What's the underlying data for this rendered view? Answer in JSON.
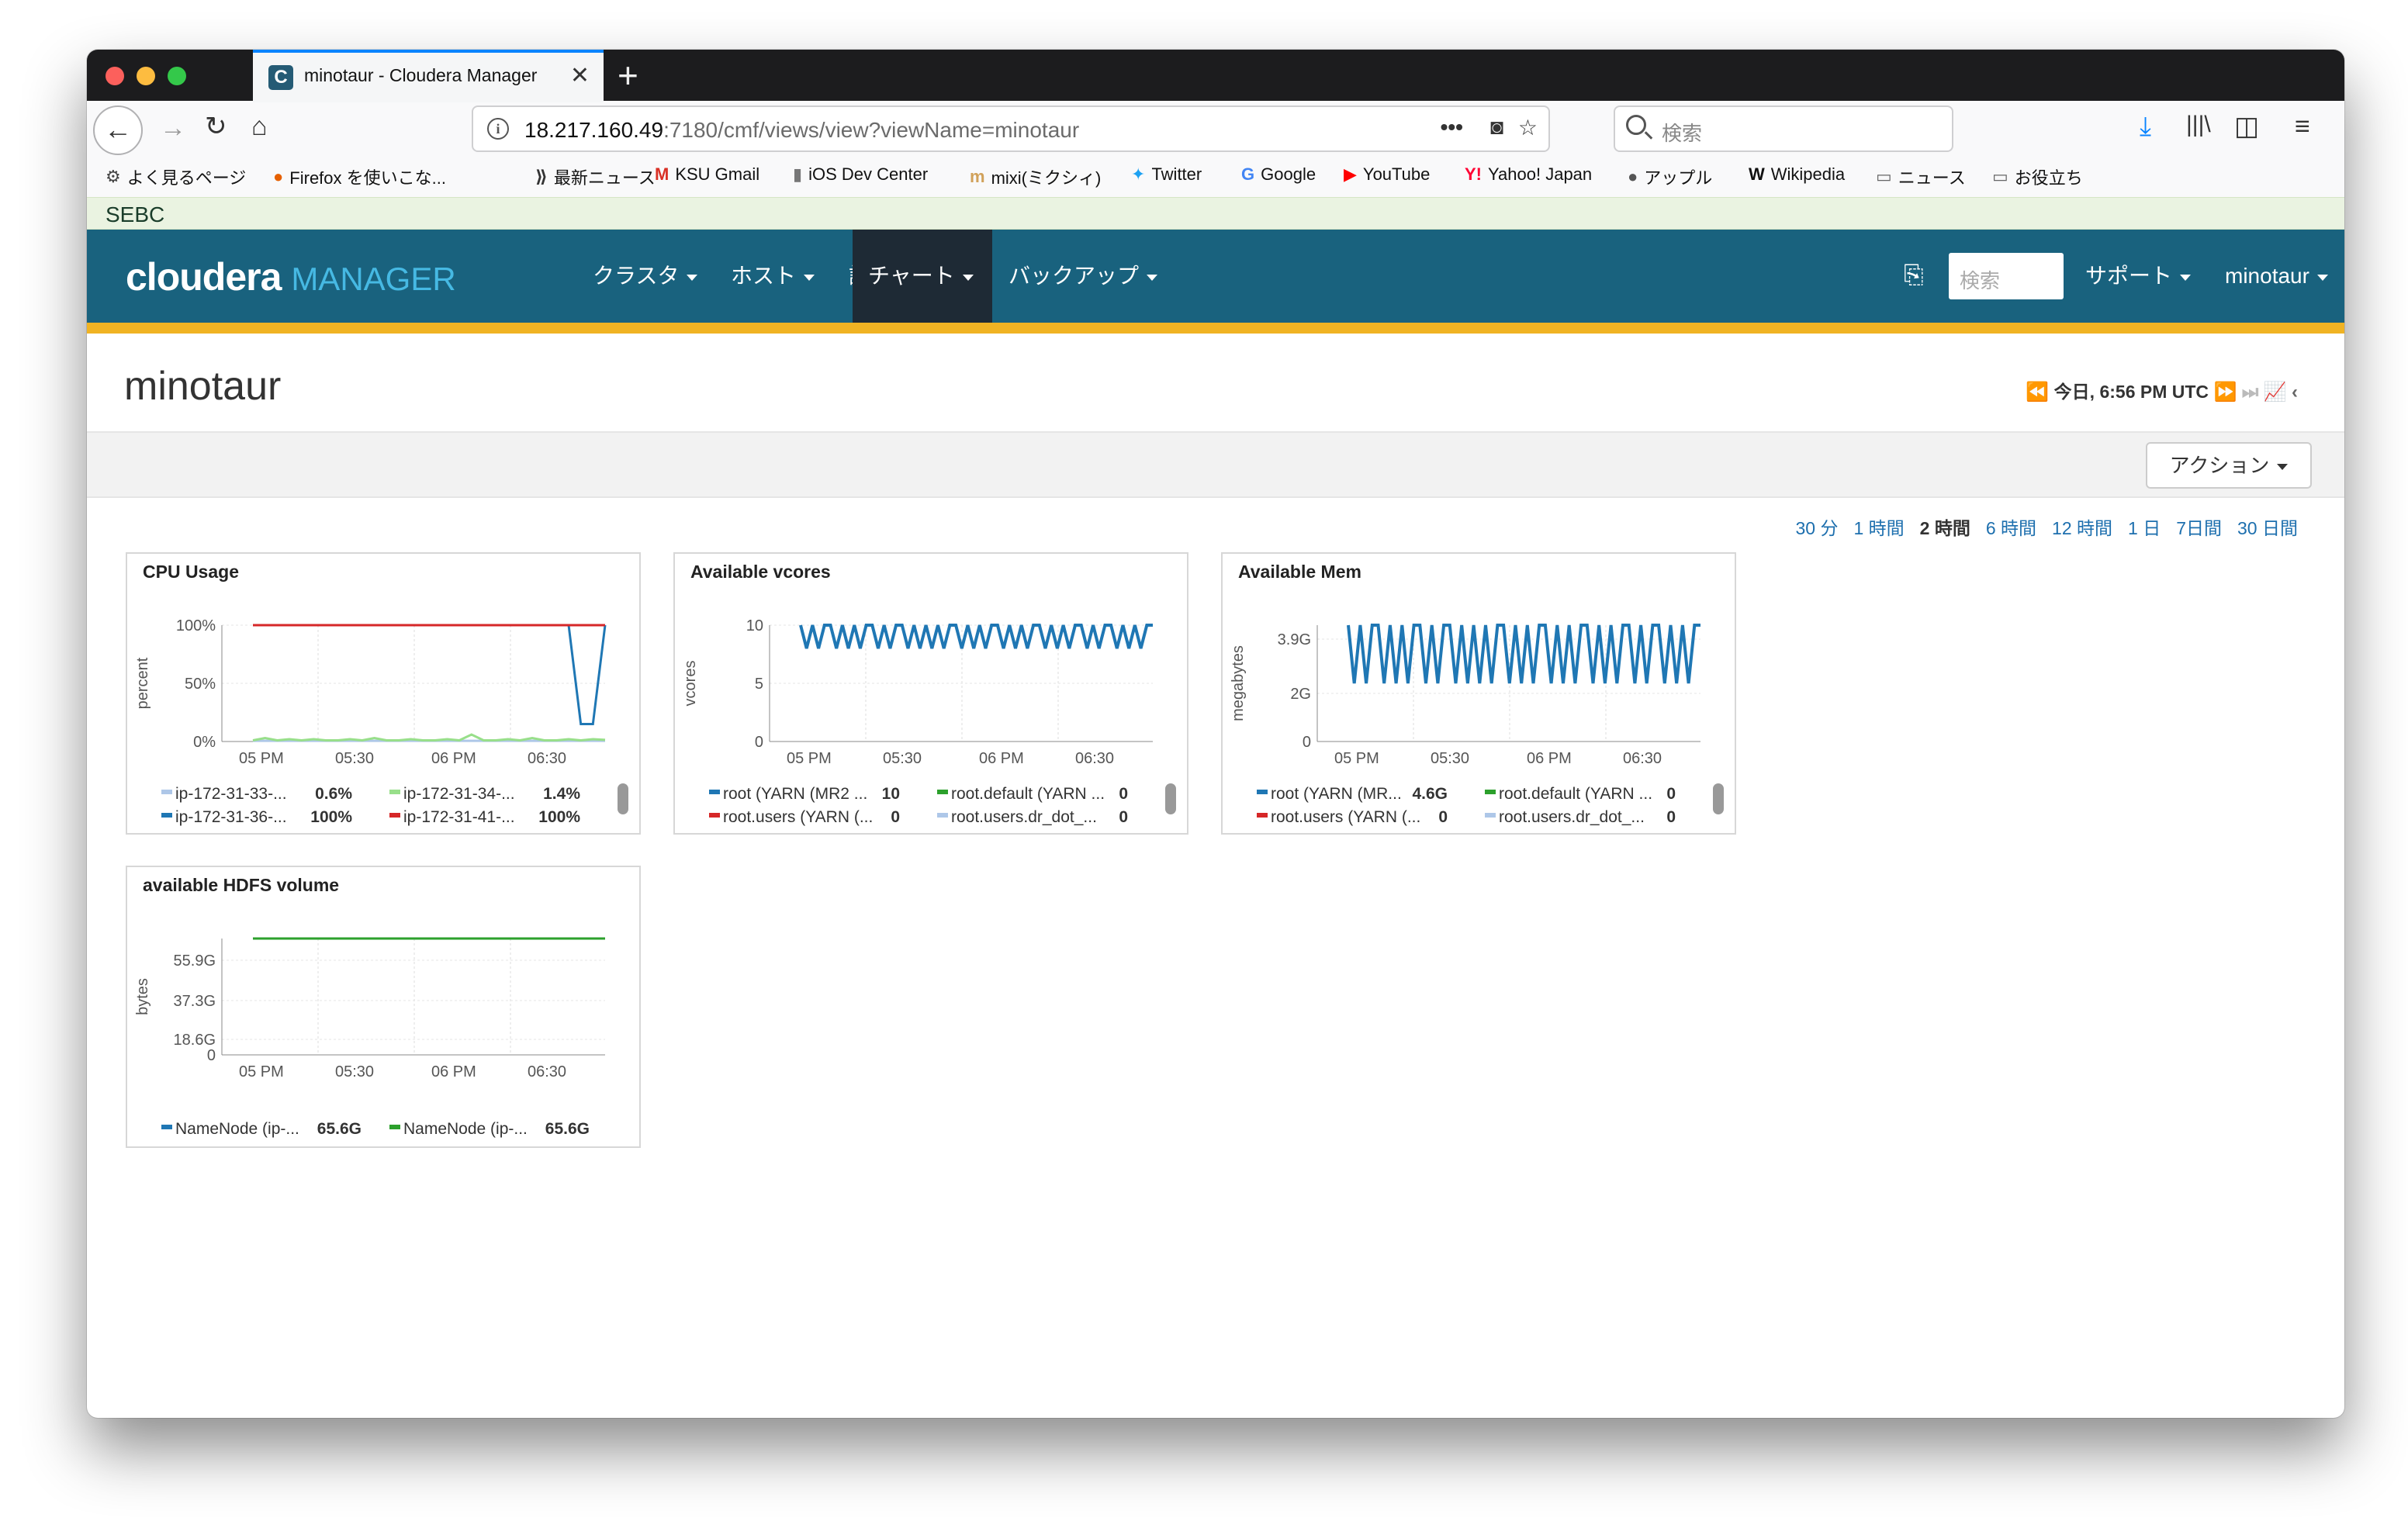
{
  "browser": {
    "tab_title": "minotaur - Cloudera Manager",
    "url_host": "18.217.160.49",
    "url_path": ":7180/cmf/views/view?viewName=minotaur",
    "search_placeholder": "検索"
  },
  "bookmarks": [
    {
      "label": "よく見るページ",
      "icon": "gear-icon",
      "color": "#444"
    },
    {
      "label": "Firefox を使いこな...",
      "icon": "firefox-icon",
      "color": "#e66000"
    },
    {
      "label": "最新ニュース",
      "icon": "rss-icon",
      "color": "#333"
    },
    {
      "label": "KSU Gmail",
      "icon": "gmail-icon",
      "color": "#d93025"
    },
    {
      "label": "iOS Dev Center",
      "icon": "apple-dev-icon",
      "color": "#777"
    },
    {
      "label": "mixi(ミクシィ)",
      "icon": "mixi-icon",
      "color": "#d1a15a"
    },
    {
      "label": "Twitter",
      "icon": "twitter-icon",
      "color": "#1da1f2"
    },
    {
      "label": "Google",
      "icon": "google-icon",
      "color": "#4285f4"
    },
    {
      "label": "YouTube",
      "icon": "youtube-icon",
      "color": "#ff0000"
    },
    {
      "label": "Yahoo! Japan",
      "icon": "yahoo-icon",
      "color": "#ff0033"
    },
    {
      "label": "アップル",
      "icon": "apple-icon",
      "color": "#555"
    },
    {
      "label": "Wikipedia",
      "icon": "wikipedia-icon",
      "color": "#111"
    },
    {
      "label": "ニュース",
      "icon": "folder-icon",
      "color": "#666"
    },
    {
      "label": "お役立ち",
      "icon": "folder-icon",
      "color": "#666"
    }
  ],
  "env_label": "SEBC",
  "header": {
    "logo_main": "cloudera",
    "logo_sub": "MANAGER",
    "menus": [
      "クラスタ",
      "ホスト",
      "診断",
      "チャート",
      "バックアップ"
    ],
    "active_menu": "チャート",
    "search_placeholder": "検索",
    "support": "サポート",
    "user": "minotaur"
  },
  "page": {
    "title": "minotaur",
    "time_label": "今日, 6:56 PM UTC",
    "action_label": "アクション",
    "ranges": [
      "30 分",
      "1 時間",
      "2 時間",
      "6 時間",
      "12 時間",
      "1 日",
      "7日間",
      "30 日間"
    ],
    "selected_range": "2 時間"
  },
  "colors": {
    "blue": "#1f77b4",
    "lightblue": "#aec7e8",
    "green": "#2ca02c",
    "lightgreen": "#98df8a",
    "red": "#d62728"
  },
  "chart_data": [
    {
      "type": "line",
      "title": "CPU Usage",
      "ylabel": "percent",
      "ylim": [
        0,
        100
      ],
      "yticks": [
        "100%",
        "50%",
        "0%"
      ],
      "xticks": [
        "05 PM",
        "05:30",
        "06 PM",
        "06:30"
      ],
      "series": [
        {
          "name": "ip-172-31-33-...",
          "value": "0.6%",
          "color": "#aec7e8",
          "values": [
            0.6,
            0.6,
            0.6,
            0.6,
            0.6,
            0.6,
            0.6,
            0.6,
            0.6,
            0.6,
            0.6,
            0.6,
            0.6,
            0.6,
            0.6,
            0.6,
            0.6,
            0.6,
            0.6,
            0.6,
            0.6,
            0.6,
            0.6,
            0.6,
            0.6,
            0.6,
            0.6,
            0.6,
            0.6,
            0.6
          ]
        },
        {
          "name": "ip-172-31-34-...",
          "value": "1.4%",
          "color": "#98df8a",
          "values": [
            1,
            3,
            1,
            2,
            1,
            2,
            1,
            1,
            2,
            1,
            3,
            1,
            1,
            2,
            1,
            1,
            2,
            1,
            6,
            1,
            1,
            2,
            1,
            3,
            1,
            1,
            2,
            1,
            2,
            1.4
          ]
        },
        {
          "name": "ip-172-31-36-...",
          "value": "100%",
          "color": "#1f77b4",
          "values": [
            100,
            100,
            100,
            100,
            100,
            100,
            100,
            100,
            100,
            100,
            100,
            100,
            100,
            100,
            100,
            100,
            100,
            100,
            100,
            100,
            100,
            100,
            100,
            100,
            100,
            100,
            100,
            15,
            15,
            100
          ]
        },
        {
          "name": "ip-172-31-41-...",
          "value": "100%",
          "color": "#d62728",
          "values": [
            100,
            100,
            100,
            100,
            100,
            100,
            100,
            100,
            100,
            100,
            100,
            100,
            100,
            100,
            100,
            100,
            100,
            100,
            100,
            100,
            100,
            100,
            100,
            100,
            100,
            100,
            100,
            100,
            100,
            100
          ]
        }
      ]
    },
    {
      "type": "line",
      "title": "Available vcores",
      "ylabel": "vcores",
      "ylim": [
        0,
        10
      ],
      "yticks": [
        "10",
        "5",
        "0"
      ],
      "xticks": [
        "05 PM",
        "05:30",
        "06 PM",
        "06:30"
      ],
      "series": [
        {
          "name": "root (YARN (MR2 ...",
          "value": "10",
          "color": "#1f77b4",
          "values": [
            10,
            8,
            10,
            8,
            10,
            10,
            8,
            10,
            8,
            10,
            8,
            10,
            10,
            8,
            10,
            8,
            10,
            10,
            8,
            10,
            8,
            10,
            8,
            10,
            8,
            10,
            10,
            8,
            10,
            8,
            10,
            8,
            10,
            10,
            8,
            10,
            8,
            10,
            8,
            10,
            10,
            8,
            10,
            8,
            10,
            8,
            10,
            10,
            8,
            10,
            8,
            10,
            10,
            8,
            10,
            8,
            10,
            8,
            10,
            10
          ]
        },
        {
          "name": "root.default (YARN ...",
          "value": "0",
          "color": "#2ca02c",
          "values": []
        },
        {
          "name": "root.users (YARN (...",
          "value": "0",
          "color": "#d62728",
          "values": []
        },
        {
          "name": "root.users.dr_dot_...",
          "value": "0",
          "color": "#aec7e8",
          "values": []
        }
      ]
    },
    {
      "type": "line",
      "title": "Available Mem",
      "ylabel": "megabytes",
      "ylim": [
        0,
        4.6
      ],
      "yticks": [
        "3.9G",
        "2G",
        "0"
      ],
      "xticks": [
        "05 PM",
        "05:30",
        "06 PM",
        "06:30"
      ],
      "series": [
        {
          "name": "root (YARN (MR...",
          "value": "4.6G",
          "color": "#1f77b4",
          "values": [
            4.6,
            2.3,
            4.6,
            2.3,
            4.6,
            4.6,
            2.3,
            4.6,
            2.3,
            4.6,
            2.3,
            4.6,
            4.6,
            2.3,
            4.6,
            2.3,
            4.6,
            4.6,
            2.3,
            4.6,
            2.3,
            4.6,
            2.3,
            4.6,
            2.3,
            4.6,
            4.6,
            2.3,
            4.6,
            2.3,
            4.6,
            2.3,
            4.6,
            4.6,
            2.3,
            4.6,
            2.3,
            4.6,
            2.3,
            4.6,
            4.6,
            2.3,
            4.6,
            2.3,
            4.6,
            2.3,
            4.6,
            4.6,
            2.3,
            4.6,
            2.3,
            4.6,
            4.6,
            2.3,
            4.6,
            2.3,
            4.6,
            2.3,
            4.6,
            4.6
          ]
        },
        {
          "name": "root.default (YARN ...",
          "value": "0",
          "color": "#2ca02c",
          "values": []
        },
        {
          "name": "root.users (YARN (...",
          "value": "0",
          "color": "#d62728",
          "values": []
        },
        {
          "name": "root.users.dr_dot_...",
          "value": "0",
          "color": "#aec7e8",
          "values": []
        }
      ]
    },
    {
      "type": "line",
      "title": "available HDFS volume",
      "ylabel": "bytes",
      "ylim": [
        0,
        65.6
      ],
      "yticks": [
        "55.9G",
        "37.3G",
        "18.6G",
        "0"
      ],
      "xticks": [
        "05 PM",
        "05:30",
        "06 PM",
        "06:30"
      ],
      "series": [
        {
          "name": "NameNode (ip-...",
          "value": "65.6G",
          "color": "#1f77b4",
          "values": [
            65.6,
            65.6,
            65.6,
            65.6,
            65.6,
            65.6,
            65.6,
            65.6,
            65.6,
            65.6
          ]
        },
        {
          "name": "NameNode (ip-...",
          "value": "65.6G",
          "color": "#2ca02c",
          "values": [
            65.6,
            65.6,
            65.6,
            65.6,
            65.6,
            65.6,
            65.6,
            65.6,
            65.6,
            65.6
          ]
        }
      ]
    }
  ]
}
